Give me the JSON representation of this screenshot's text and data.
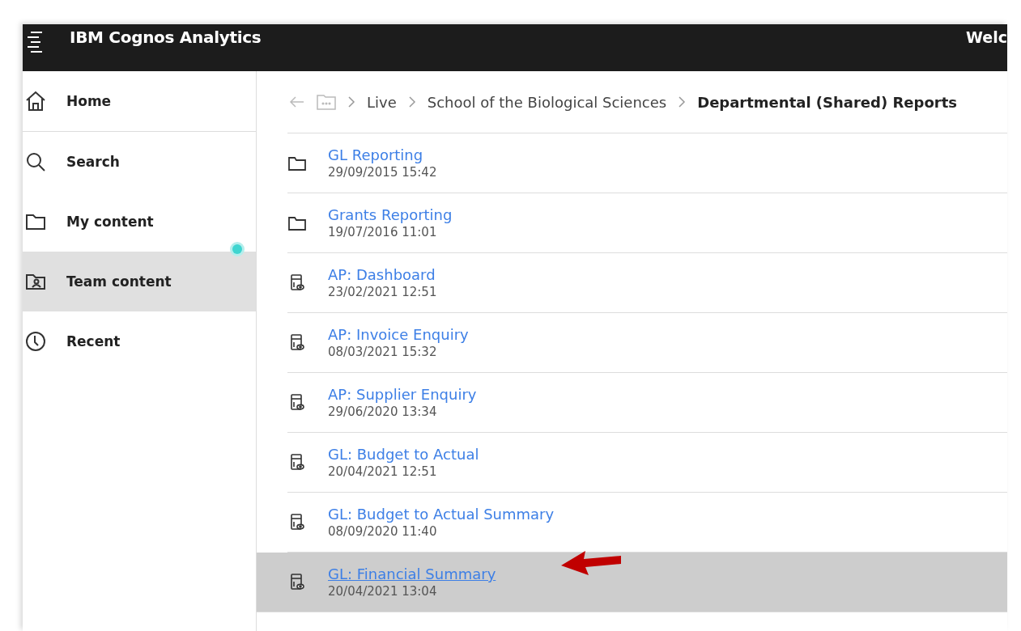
{
  "header": {
    "title": "IBM Cognos Analytics",
    "welcome": "Welc"
  },
  "sidebar": {
    "items": [
      {
        "label": "Home",
        "kind": "home",
        "selected": false,
        "notification": false
      },
      {
        "label": "Search",
        "kind": "search",
        "selected": false,
        "notification": false
      },
      {
        "label": "My content",
        "kind": "folder",
        "selected": false,
        "notification": false
      },
      {
        "label": "Team content",
        "kind": "team",
        "selected": true,
        "notification": true
      },
      {
        "label": "Recent",
        "kind": "clock",
        "selected": false,
        "notification": false
      }
    ]
  },
  "breadcrumb": [
    "Live",
    "School of the Biological Sciences",
    "Departmental (Shared) Reports"
  ],
  "rows": [
    {
      "kind": "folder",
      "name": "GL Reporting",
      "modified": "29/09/2015 15:42",
      "selected": false
    },
    {
      "kind": "folder",
      "name": "Grants Reporting",
      "modified": "19/07/2016 11:01",
      "selected": false
    },
    {
      "kind": "report",
      "name": "AP: Dashboard",
      "modified": "23/02/2021 12:51",
      "selected": false
    },
    {
      "kind": "report",
      "name": "AP: Invoice Enquiry",
      "modified": "08/03/2021 15:32",
      "selected": false
    },
    {
      "kind": "report",
      "name": "AP: Supplier Enquiry",
      "modified": "29/06/2020 13:34",
      "selected": false
    },
    {
      "kind": "report",
      "name": "GL: Budget to Actual",
      "modified": "20/04/2021 12:51",
      "selected": false
    },
    {
      "kind": "report",
      "name": "GL: Budget to Actual Summary",
      "modified": "08/09/2020 11:40",
      "selected": false
    },
    {
      "kind": "report",
      "name": "GL: Financial Summary",
      "modified": "20/04/2021 13:04",
      "selected": true
    }
  ]
}
